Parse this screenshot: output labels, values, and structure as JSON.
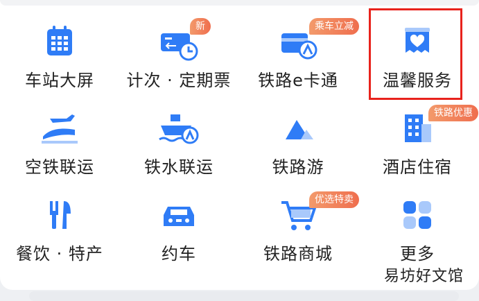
{
  "services": [
    {
      "label": "车站大屏",
      "icon": "station-screen-icon"
    },
    {
      "label": "计次 · 定期票",
      "icon": "ticket-clock-icon",
      "badge": "新"
    },
    {
      "label": "铁路e卡通",
      "icon": "ecard-icon",
      "badge": "乘车立减"
    },
    {
      "label": "温馨服务",
      "icon": "heart-bag-icon"
    },
    {
      "label": "空铁联运",
      "icon": "plane-train-icon"
    },
    {
      "label": "铁水联运",
      "icon": "ship-train-icon"
    },
    {
      "label": "铁路游",
      "icon": "mountain-icon"
    },
    {
      "label": "酒店住宿",
      "icon": "hotel-icon",
      "badge": "铁路优惠"
    },
    {
      "label": "餐饮 · 特产",
      "icon": "fork-knife-icon"
    },
    {
      "label": "约车",
      "icon": "car-icon"
    },
    {
      "label": "铁路商城",
      "icon": "shopping-cart-icon",
      "badge": "优选特卖"
    },
    {
      "label": "更多",
      "icon": "more-grid-icon"
    }
  ],
  "watermark": "易坊好文馆",
  "colors": {
    "icon_blue": "#2f7cf6",
    "icon_light": "#a9c9fb",
    "badge_orange": "#ef6e4e",
    "highlight_red": "#e8221c"
  }
}
